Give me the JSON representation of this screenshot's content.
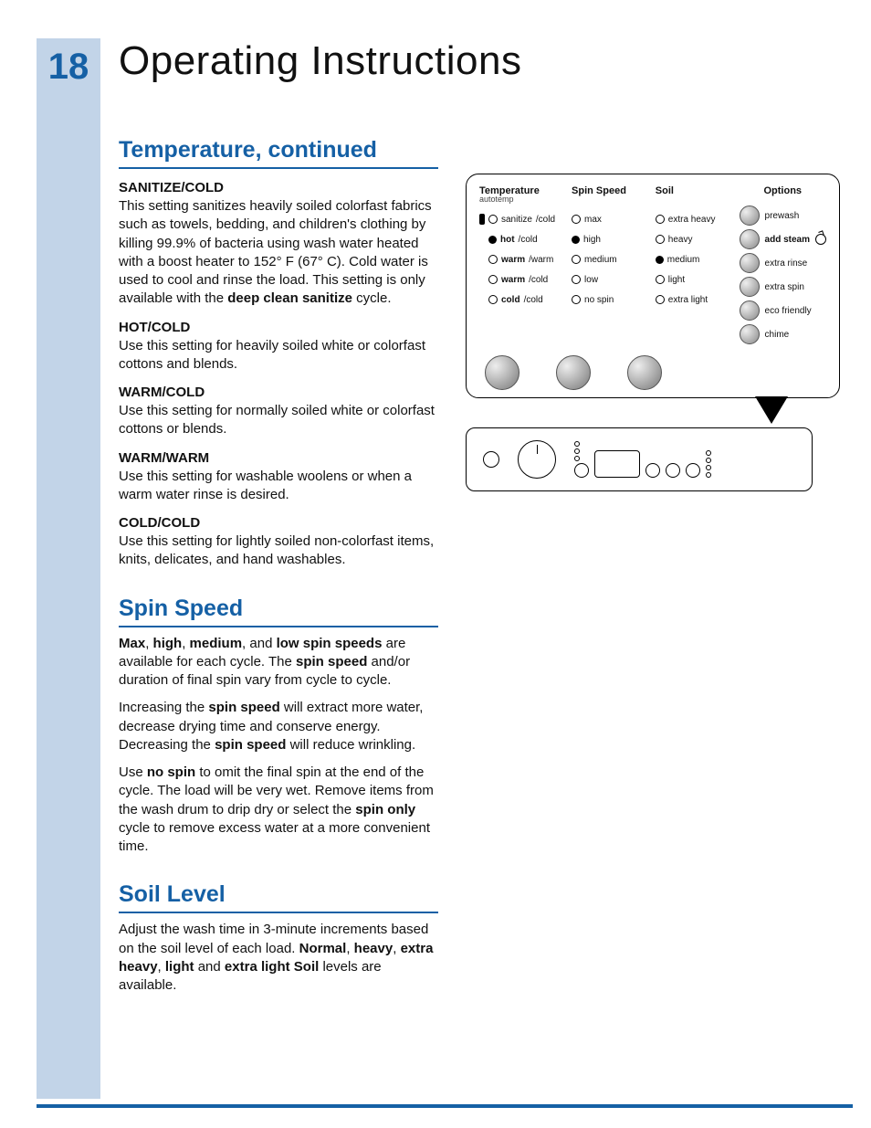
{
  "page_number": "18",
  "chapter_title": "Operating Instructions",
  "sections": {
    "temperature": {
      "heading": "Temperature, continued",
      "items": {
        "sanitize": {
          "title": "SANITIZE/COLD",
          "text_1": "This setting sanitizes heavily soiled colorfast fabrics such as towels, bedding, and children's clothing by killing 99.9% of bacteria using wash water heated with a boost heater to 152° F (67° C). Cold water is used to cool and rinse the load. This setting is only available with the ",
          "bold_1": "deep clean sanitize",
          "text_2": " cycle."
        },
        "hot": {
          "title": "HOT/COLD",
          "text": "Use this setting for heavily soiled white or colorfast cottons and blends."
        },
        "warm_cold": {
          "title": "WARM/COLD",
          "text": "Use this setting for normally soiled white or colorfast cottons or blends."
        },
        "warm_warm": {
          "title": "WARM/WARM",
          "text": "Use this setting for washable woolens or when a warm water rinse is desired."
        },
        "cold": {
          "title": "COLD/COLD",
          "text": "Use this setting for lightly soiled non-colorfast items, knits, delicates, and hand washables."
        }
      }
    },
    "spin": {
      "heading": "Spin Speed",
      "p1": {
        "b1": "Max",
        "t1": ", ",
        "b2": "high",
        "t2": ", ",
        "b3": "medium",
        "t3": ", and ",
        "b4": "low spin speeds",
        "t4": " are available for each cycle. The ",
        "b5": "spin speed",
        "t5": " and/or duration of final spin vary from cycle to cycle."
      },
      "p2": {
        "t1": "Increasing the ",
        "b1": "spin speed",
        "t2": " will extract more water, decrease drying time and conserve energy. Decreasing the ",
        "b2": "spin speed",
        "t3": " will reduce wrinkling."
      },
      "p3": {
        "t1": "Use ",
        "b1": "no spin",
        "t2": " to omit the final spin at the end of the cycle. The load will be very wet. Remove items from the wash drum to drip dry or select the ",
        "b2": "spin only",
        "t3": " cycle to remove excess water at a more convenient time."
      }
    },
    "soil": {
      "heading": "Soil Level",
      "p1": {
        "t1": "Adjust the wash time in 3-minute increments based on the soil level of each load. ",
        "b1": "Normal",
        "t2": ", ",
        "b2": "heavy",
        "t3": ", ",
        "b3": "extra heavy",
        "t4": ", ",
        "b4": "light",
        "t5": " and ",
        "b5": "extra light Soil",
        "t6": " levels are available."
      }
    }
  },
  "panel": {
    "headers": {
      "temp": "Temperature",
      "temp_sub": "autotemp",
      "spin": "Spin Speed",
      "soil": "Soil",
      "options": "Options"
    },
    "temp": {
      "r1a": "sanitize",
      "r1b": "/cold",
      "r2a": "hot",
      "r2b": "/cold",
      "r3a": "warm",
      "r3b": "/warm",
      "r4a": "warm",
      "r4b": "/cold",
      "r5a": "cold",
      "r5b": "/cold"
    },
    "spin": {
      "r1": "max",
      "r2": "high",
      "r3": "medium",
      "r4": "low",
      "r5": "no spin"
    },
    "soil": {
      "r1": "extra heavy",
      "r2": "heavy",
      "r3": "medium",
      "r4": "light",
      "r5": "extra light"
    },
    "options": {
      "r1": "prewash",
      "r2": "add steam",
      "r3": "extra rinse",
      "r4": "extra spin",
      "r5": "eco friendly",
      "r6": "chime"
    }
  }
}
